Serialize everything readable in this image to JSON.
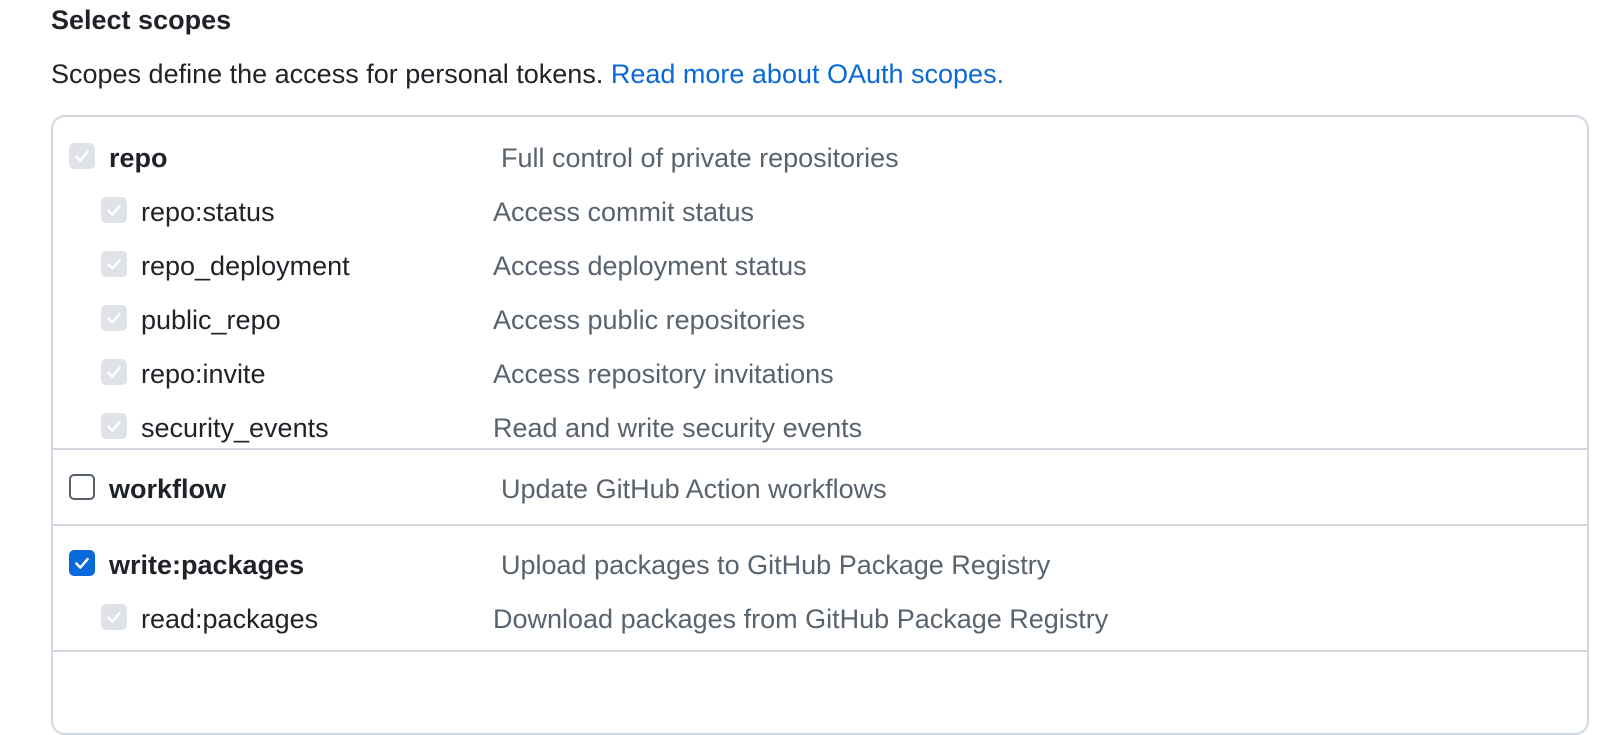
{
  "section": {
    "title": "Select scopes",
    "description": "Scopes define the access for personal tokens.",
    "link_text": "Read more about OAuth scopes."
  },
  "colors": {
    "accent": "#0969da",
    "border": "#d0d7de",
    "muted_text": "#59636e",
    "disabled_checkbox": "#dfe3e8"
  },
  "scopes": {
    "repo": {
      "name": "repo",
      "description": "Full control of private repositories",
      "state": "checked-disabled",
      "children": [
        {
          "name": "repo:status",
          "description": "Access commit status",
          "state": "checked-disabled"
        },
        {
          "name": "repo_deployment",
          "description": "Access deployment status",
          "state": "checked-disabled"
        },
        {
          "name": "public_repo",
          "description": "Access public repositories",
          "state": "checked-disabled"
        },
        {
          "name": "repo:invite",
          "description": "Access repository invitations",
          "state": "checked-disabled"
        },
        {
          "name": "security_events",
          "description": "Read and write security events",
          "state": "checked-disabled"
        }
      ]
    },
    "workflow": {
      "name": "workflow",
      "description": "Update GitHub Action workflows",
      "state": "unchecked"
    },
    "write_packages": {
      "name": "write:packages",
      "description": "Upload packages to GitHub Package Registry",
      "state": "checked",
      "children": [
        {
          "name": "read:packages",
          "description": "Download packages from GitHub Package Registry",
          "state": "checked-disabled"
        }
      ]
    }
  }
}
